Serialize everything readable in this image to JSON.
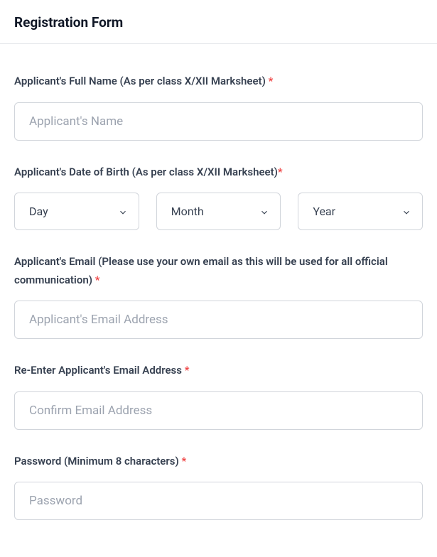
{
  "header": {
    "title": "Registration Form"
  },
  "fields": {
    "fullName": {
      "label": "Applicant's Full Name (As per class X/XII Marksheet) ",
      "placeholder": "Applicant's Name",
      "required": "*"
    },
    "dob": {
      "label": "Applicant's Date of Birth (As per class X/XII Marksheet)",
      "required": "*",
      "day": "Day",
      "month": "Month",
      "year": "Year"
    },
    "email": {
      "label": "Applicant's Email (Please use your own email as this will be used for all official communication) ",
      "placeholder": "Applicant's Email Address",
      "required": "*"
    },
    "confirmEmail": {
      "label": "Re-Enter Applicant's Email Address ",
      "placeholder": "Confirm Email Address",
      "required": "*"
    },
    "password": {
      "label": "Password (Minimum 8 characters) ",
      "placeholder": "Password",
      "required": "*"
    }
  }
}
